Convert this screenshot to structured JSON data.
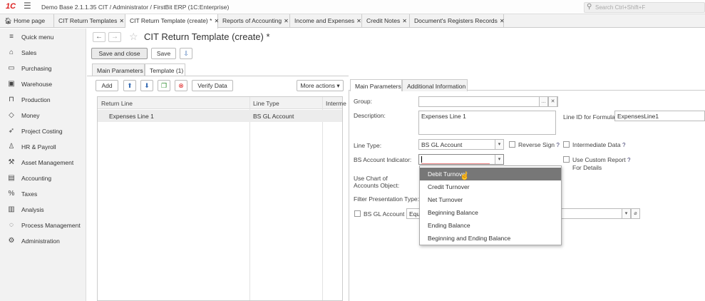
{
  "titlebar": {
    "logo": "1C",
    "title": "Demo Base 2.1.1.35 CIT / Administrator / FirstBit ERP  (1C:Enterprise)",
    "search_placeholder": "Search Ctrl+Shift+F"
  },
  "tabs": [
    {
      "label": "Home page",
      "closable": false
    },
    {
      "label": "CIT Return Templates",
      "closable": true
    },
    {
      "label": "CIT Return Template (create) *",
      "closable": true,
      "active": true
    },
    {
      "label": "Reports of Accounting",
      "closable": true
    },
    {
      "label": "Income and Expenses",
      "closable": true
    },
    {
      "label": "Credit Notes",
      "closable": true
    },
    {
      "label": "Document's Registers Records",
      "closable": true
    }
  ],
  "sidebar": {
    "items": [
      {
        "label": "Quick menu",
        "icon": "menu-icon"
      },
      {
        "label": "Sales",
        "icon": "shop-icon"
      },
      {
        "label": "Purchasing",
        "icon": "truck-icon"
      },
      {
        "label": "Warehouse",
        "icon": "warehouse-icon"
      },
      {
        "label": "Production",
        "icon": "factory-icon"
      },
      {
        "label": "Money",
        "icon": "money-icon"
      },
      {
        "label": "Project Costing",
        "icon": "rocket-icon"
      },
      {
        "label": "HR & Payroll",
        "icon": "person-icon"
      },
      {
        "label": "Asset Management",
        "icon": "asset-icon"
      },
      {
        "label": "Accounting",
        "icon": "ledger-icon"
      },
      {
        "label": "Taxes",
        "icon": "percent-icon"
      },
      {
        "label": "Analysis",
        "icon": "chart-icon"
      },
      {
        "label": "Process Management",
        "icon": "process-icon"
      },
      {
        "label": "Administration",
        "icon": "gear-icon"
      }
    ]
  },
  "document": {
    "title": "CIT Return Template (create) *",
    "save_and_close": "Save and close",
    "save": "Save"
  },
  "form_tabs": [
    "Main Parameters",
    "Template (1)"
  ],
  "template_toolbar": {
    "add": "Add",
    "verify": "Verify Data",
    "more_actions": "More actions"
  },
  "table": {
    "columns": [
      "Return Line",
      "Line Type",
      "Interme"
    ],
    "rows": [
      {
        "return_line": "Expenses Line 1",
        "line_type": "BS GL Account"
      }
    ]
  },
  "detail_tabs": [
    "Main Parameters",
    "Additional Information"
  ],
  "detail": {
    "group_label": "Group:",
    "group_value": "",
    "description_label": "Description:",
    "description_value": "Expenses Line 1",
    "line_id_label": "Line ID for Formula:",
    "line_id_value": "ExpensesLine1",
    "line_type_label": "Line Type:",
    "line_type_value": "BS GL Account",
    "reverse_sign": "Reverse Sign",
    "intermediate_data": "Intermediate Data",
    "bs_indicator_label": "BS Account Indicator:",
    "bs_indicator_value": "",
    "use_custom_report": "Use Custom Report",
    "for_details": "For Details",
    "use_chart_label_1": "Use Chart of",
    "use_chart_label_2": "Accounts Object:",
    "filter_label": "Filter Presentation Type:",
    "bs_gl_account": "BS GL Account",
    "bs_gl_value": "Equ",
    "q": "?"
  },
  "dropdown": {
    "options": [
      "Debit Turnover",
      "Credit Turnover",
      "Net Turnover",
      "Beginning Balance",
      "Ending Balance",
      "Beginning and Ending Balance"
    ],
    "highlighted": "Debit Turnover"
  },
  "colors": {
    "accent_logo": "#dd2222",
    "selected_option_bg": "#777777"
  }
}
